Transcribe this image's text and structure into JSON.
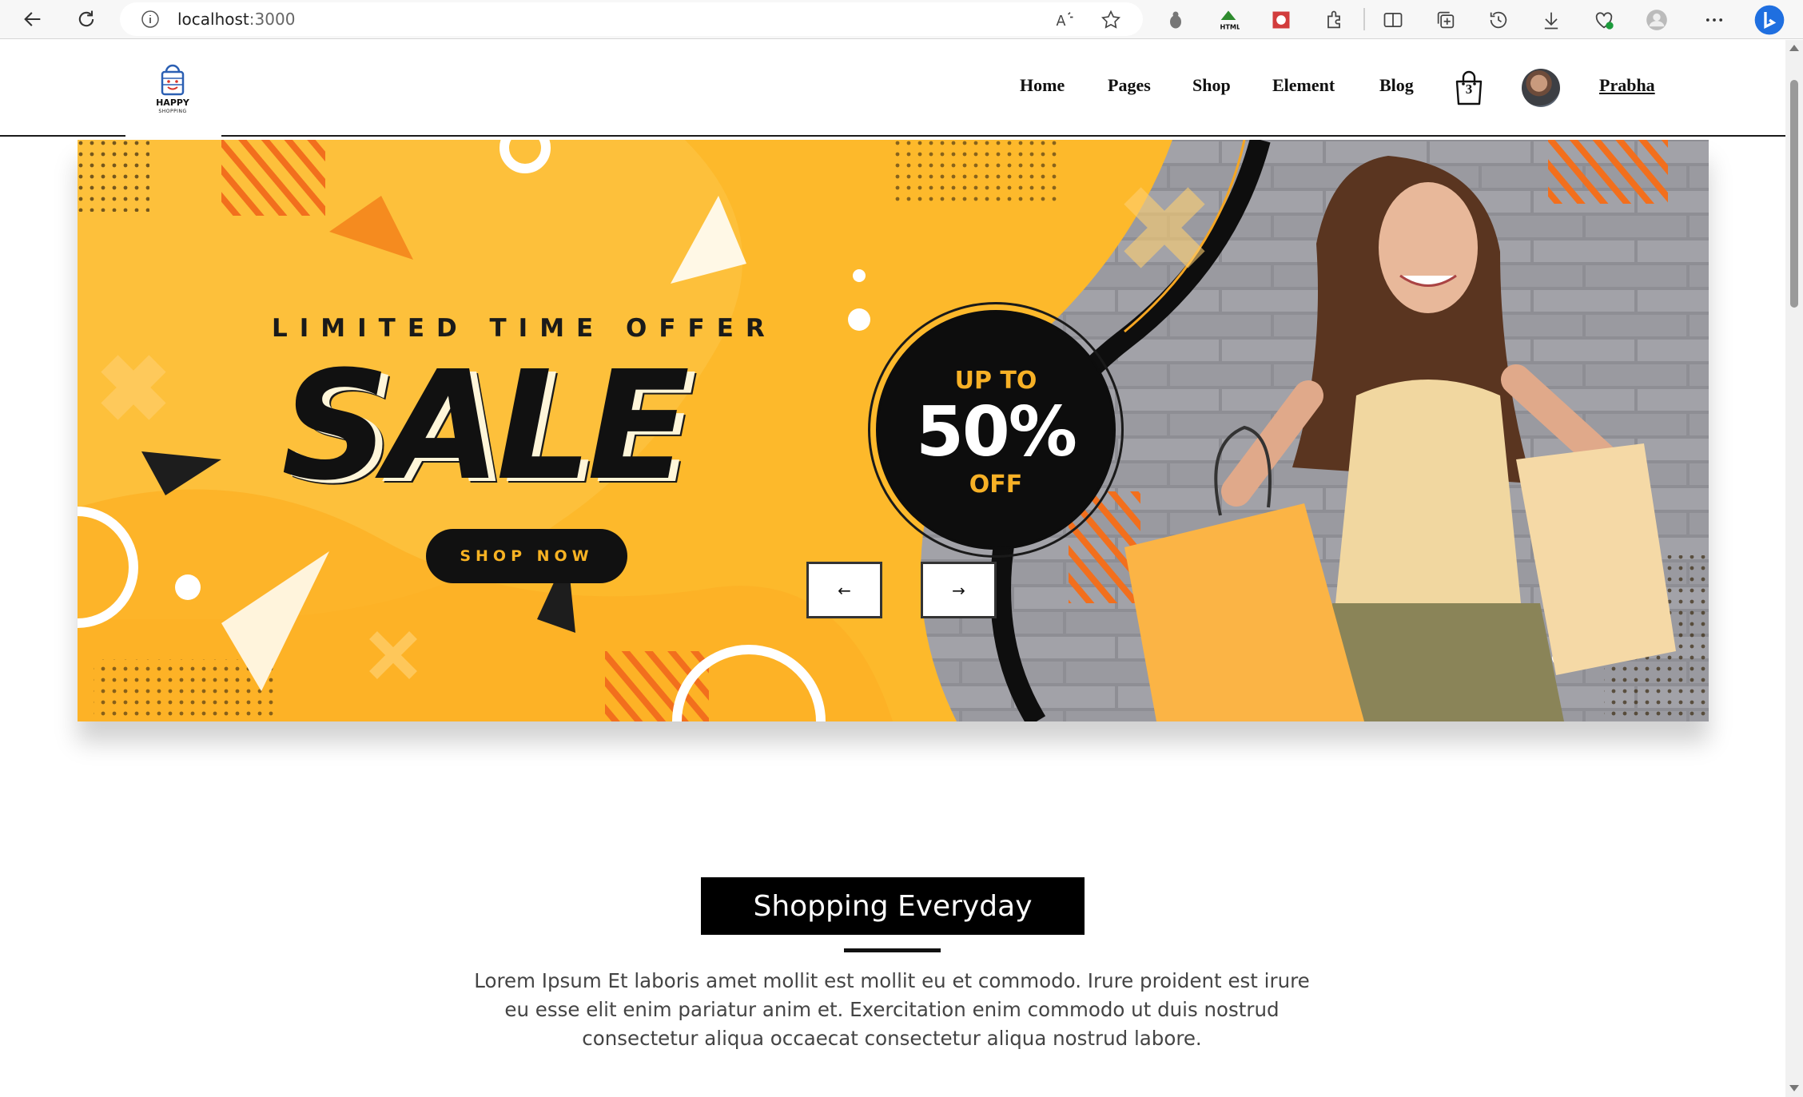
{
  "browser": {
    "url_host": "localhost",
    "url_port": ":3000"
  },
  "site": {
    "logo_line1": "HAPPY",
    "logo_line2": "SHOPPING",
    "nav": [
      "Home",
      "Pages",
      "Shop",
      "Element",
      "Blog"
    ],
    "cart_count": "3",
    "username": "Prabha"
  },
  "banner": {
    "tagline": "LIMITED TIME OFFER",
    "headline": "SALE",
    "cta": "SHOP NOW",
    "badge_top": "UP TO",
    "badge_value": "50%",
    "badge_bottom": "OFF",
    "prev_label": "←",
    "next_label": "→",
    "colors": {
      "primary": "#fdb92b",
      "accent": "#f58b1f",
      "dark": "#111111"
    }
  },
  "section": {
    "title": "Shopping Everyday",
    "text": "Lorem Ipsum Et laboris amet mollit est mollit eu et commodo. Irure proident est irure eu esse elit enim pariatur anim et. Exercitation enim commodo ut duis nostrud consectetur aliqua occaecat consectetur aliqua nostrud labore."
  }
}
